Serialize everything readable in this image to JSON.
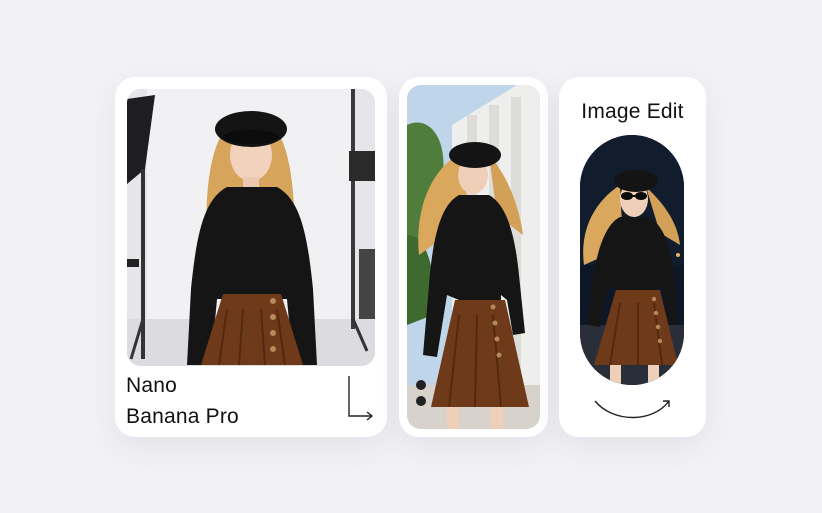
{
  "cards": [
    {
      "title_line1": "Nano",
      "title_line2": "Banana Pro",
      "image": "woman-studio-photo",
      "icon": "corner-down-right-arrow-icon"
    },
    {
      "image": "woman-street-photo"
    },
    {
      "title": "Image Edit",
      "image": "woman-night-sunglasses-photo",
      "icon": "curved-arrow-icon"
    }
  ],
  "colors": {
    "background": "#f2f2f6",
    "card": "#ffffff",
    "text": "#111111",
    "shirt": "#111111",
    "skirt": "#6e3a1a",
    "hair": "#d9a85c"
  }
}
